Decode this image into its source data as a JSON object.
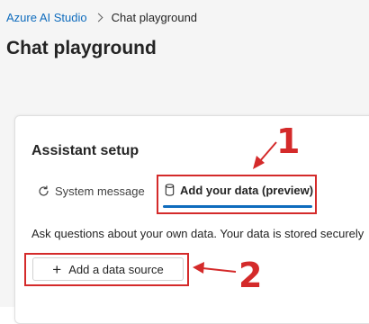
{
  "breadcrumb": {
    "root": "Azure AI Studio",
    "current": "Chat playground"
  },
  "page": {
    "title": "Chat playground"
  },
  "assistant_setup": {
    "title": "Assistant setup",
    "tabs": [
      {
        "label": "System message",
        "icon": "sync-icon",
        "selected": false
      },
      {
        "label": "Add your data (preview)",
        "icon": "database-icon",
        "selected": true
      }
    ],
    "description": "Ask questions about your own data. Your data is stored securely",
    "add_source_label": "Add a data source"
  },
  "annotations": {
    "callout_1": "1",
    "callout_2": "2"
  },
  "colors": {
    "accent": "#0f6cbd",
    "annotation": "#d42a2a"
  }
}
